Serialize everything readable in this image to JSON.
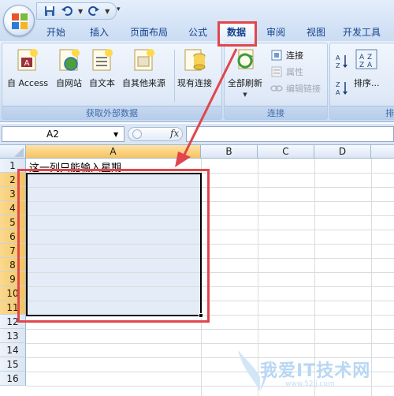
{
  "quick_access": {
    "save_icon": "save-icon",
    "undo_icon": "undo-icon",
    "redo_icon": "redo-icon",
    "more_glyph": "▾"
  },
  "tabs": [
    {
      "label": "开始",
      "active": false
    },
    {
      "label": "插入",
      "active": false
    },
    {
      "label": "页面布局",
      "active": false
    },
    {
      "label": "公式",
      "active": false
    },
    {
      "label": "数据",
      "active": true
    },
    {
      "label": "审阅",
      "active": false
    },
    {
      "label": "视图",
      "active": false
    },
    {
      "label": "开发工具",
      "active": false
    }
  ],
  "ribbon": {
    "groups": {
      "external": {
        "label": "获取外部数据",
        "buttons": [
          "自 Access",
          "自网站",
          "自文本",
          "自其他来源",
          "现有连接"
        ]
      },
      "connections": {
        "label": "连接",
        "refresh_all": "全部刷新",
        "connections_btn": "连接",
        "properties_btn": "属性",
        "edit_links_btn": "编辑链接"
      },
      "sort": {
        "label": "排",
        "sort_btn": "排序..."
      }
    }
  },
  "formula_bar": {
    "name_box": "A2",
    "fx_label": "fx",
    "formula": ""
  },
  "grid": {
    "columns": [
      "A",
      "B",
      "C",
      "D"
    ],
    "rows": [
      "1",
      "2",
      "3",
      "4",
      "5",
      "6",
      "7",
      "8",
      "9",
      "10",
      "11",
      "12",
      "13",
      "14",
      "15",
      "16"
    ],
    "selected_column": "A",
    "selected_rows": [
      "2",
      "3",
      "4",
      "5",
      "6",
      "7",
      "8",
      "9",
      "10",
      "11"
    ],
    "cells": {
      "A1": "这一列只能输入星期"
    }
  },
  "watermark": {
    "text": "我爱IT技术网",
    "url": "www.52ij.com"
  },
  "colors": {
    "annotation_red": "#e0464c",
    "ribbon_blue": "#dbe7f7",
    "header_orange": "#f8c35f",
    "selection_fill": "#e4ecf7"
  }
}
